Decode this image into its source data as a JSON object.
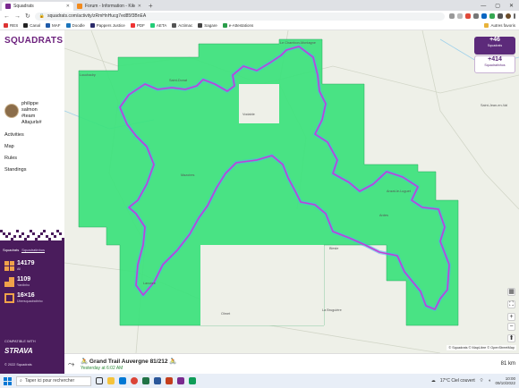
{
  "browser": {
    "tabs": [
      {
        "title": "Squadrats",
        "color": "#7a2a8f",
        "active": true
      },
      {
        "title": "Forum - Information - Kikourou",
        "color": "#f28a1d",
        "active": false
      }
    ],
    "url": "squadrats.com/activity/zRmHnHucg7ed85f3BnEA",
    "bookmarks": [
      "RES",
      "Canal",
      "MAF",
      "Doodle",
      "Pappers Justice",
      "PDF",
      "AETA",
      "Actimac",
      "Sagare",
      "e-Attestations",
      "Autres favoris"
    ]
  },
  "sidebar": {
    "logo": "SQUADRATS",
    "user": {
      "line1": "philippe",
      "line2": "salmon",
      "line3": "#team",
      "line4": "Altajurls#"
    },
    "menu": [
      "Activities",
      "Map",
      "Rules",
      "Standings"
    ],
    "panel": {
      "tab1": "Squadrats",
      "tab2": "Squadratinhos",
      "stats": [
        {
          "value": "14179",
          "label": "All",
          "color": "#f0a24a"
        },
        {
          "value": "1109",
          "label": "Yardinho",
          "color": "#f0a24a"
        },
        {
          "value": "16×16",
          "label": "Übersquadratinho",
          "color": "#f0a24a"
        }
      ],
      "compatible": "COMPATIBLE WITH",
      "strava": "STRAVA",
      "copyright": "© 2022 Squadrats"
    }
  },
  "map": {
    "badges": [
      {
        "value": "+46",
        "label": "Squadrats",
        "bg": "#5c2a7a",
        "fg": "#ffffff"
      },
      {
        "value": "+414",
        "label": "Squadratinhos",
        "bg": "#ffffff",
        "fg": "#5c2a7a"
      }
    ],
    "places": [
      "Louchadry",
      "Le Chambon-Montagne",
      "Saint-Donat",
      "Vodable",
      "Mazoires",
      "Saint-Jean-en-Val",
      "Anzat-le-Luguet",
      "Ardes",
      "Blesle",
      "Olmet",
      "La Bruguière",
      "Lanobre"
    ],
    "zoom_in": "+",
    "zoom_out": "−",
    "attribution": "© Squadrats © MapLibre © OpenStreetMap",
    "colors": {
      "covered": "#3be27b",
      "route": "#c23fd6",
      "edge": "#47b6f0"
    }
  },
  "activity": {
    "title": "🚴 Grand Trail Auvergne 81/212 🚴",
    "date": "Yesterday at 6:02 AM",
    "distance": "81 km"
  },
  "taskbar": {
    "search": "Taper ici pour rechercher",
    "weather": "17°C Ciel couvert",
    "time": "10:00",
    "date": "09/10/2022"
  }
}
